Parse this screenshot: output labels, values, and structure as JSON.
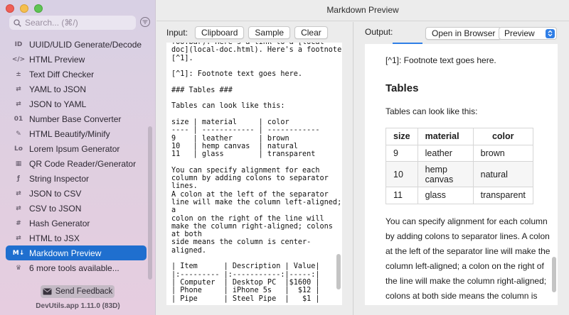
{
  "window": {
    "title": "Markdown Preview"
  },
  "sidebar": {
    "search_placeholder": "Search... (⌘/)",
    "items": [
      {
        "label": "UUID/ULID Generate/Decode",
        "icon": "uuid-icon",
        "glyph": "ID"
      },
      {
        "label": "HTML Preview",
        "icon": "code-icon",
        "glyph": "</>"
      },
      {
        "label": "Text Diff Checker",
        "icon": "diff-icon",
        "glyph": "±"
      },
      {
        "label": "YAML to JSON",
        "icon": "convert-icon",
        "glyph": "⇄"
      },
      {
        "label": "JSON to YAML",
        "icon": "convert-icon",
        "glyph": "⇄"
      },
      {
        "label": "Number Base Converter",
        "icon": "number-base-icon",
        "glyph": "01"
      },
      {
        "label": "HTML Beautify/Minify",
        "icon": "magic-wand-icon",
        "glyph": "✎"
      },
      {
        "label": "Lorem Ipsum Generator",
        "icon": "lorem-icon",
        "glyph": "Lo"
      },
      {
        "label": "QR Code Reader/Generator",
        "icon": "qr-code-icon",
        "glyph": "▦"
      },
      {
        "label": "String Inspector",
        "icon": "string-inspector-icon",
        "glyph": "ƒ"
      },
      {
        "label": "JSON to CSV",
        "icon": "convert-icon",
        "glyph": "⇄"
      },
      {
        "label": "CSV to JSON",
        "icon": "convert-icon",
        "glyph": "⇄"
      },
      {
        "label": "Hash Generator",
        "icon": "hash-icon",
        "glyph": "#"
      },
      {
        "label": "HTML to JSX",
        "icon": "convert-icon",
        "glyph": "⇄"
      },
      {
        "label": "Markdown Preview",
        "icon": "markdown-icon",
        "glyph": "M↓",
        "selected": true
      },
      {
        "label": "6 more tools available...",
        "icon": "more-tools-icon",
        "glyph": "♛"
      }
    ],
    "feedback_label": "Send Feedback",
    "version": "DevUtils.app 1.11.0 (83D)"
  },
  "input": {
    "label": "Input:",
    "buttons": {
      "clipboard": "Clipboard",
      "sample": "Sample",
      "clear": "Clear"
    },
    "text": "foo.bar). Here's a link to a [local\ndoc](local-doc.html). Here's a footnote\n[^1].\n\n[^1]: Footnote text goes here.\n\n### Tables ###\n\nTables can look like this:\n\nsize | material     | color\n---- | ------------ | ------------\n9    | leather      | brown\n10   | hemp canvas  | natural\n11   | glass        | transparent\n\nYou can specify alignment for each\ncolumn by adding colons to separator\nlines.\nA colon at the left of the separator\nline will make the column left-aligned;\na\ncolon on the right of the line will\nmake the column right-aligned; colons\nat both\nside means the column is center-\naligned.\n\n| Item      | Description | Value|\n|:--------- |:-----------:|-----:|\n| Computer  | Desktop PC  |$1600 |\n| Phone     | iPhone 5s   |  $12 |\n| Pipe      | Steel Pipe  |   $1 |"
  },
  "output": {
    "label": "Output:",
    "open_browser": "Open in Browser",
    "view_mode": "Preview",
    "footnote": "[^1]: Footnote text goes here.",
    "heading": "Tables",
    "intro": "Tables can look like this:",
    "table": {
      "headers": [
        "size",
        "material",
        "color"
      ],
      "rows": [
        [
          "9",
          "leather",
          "brown"
        ],
        [
          "10",
          "hemp canvas",
          "natural"
        ],
        [
          "11",
          "glass",
          "transparent"
        ]
      ]
    },
    "paragraph": "You can specify alignment for each column by adding colons to separator lines. A colon at the left of the separator line will make the column left-aligned; a colon on the right of the line will make the column right-aligned; colons at both side means the column is center-aligned."
  },
  "colors": {
    "accent": "#1f6fcf",
    "select_arrow": "#2f7ee6"
  }
}
